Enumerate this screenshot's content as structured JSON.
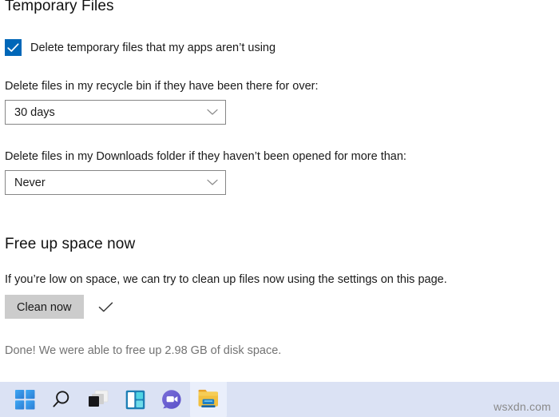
{
  "page": {
    "temp_files": {
      "title": "Temporary Files",
      "checkbox": {
        "label": "Delete temporary files that my apps aren’t using",
        "checked": true,
        "icon": "check-icon",
        "color": "#0067b8"
      },
      "recycle_bin": {
        "label": "Delete files in my recycle bin if they have been there for over:",
        "value": "30 days",
        "chevron_icon": "chevron-down-icon"
      },
      "downloads": {
        "label": "Delete files in my Downloads folder if they haven’t been opened for more than:",
        "value": "Never",
        "chevron_icon": "chevron-down-icon"
      }
    },
    "free_up_space": {
      "title": "Free up space now",
      "description": "If you’re low on space, we can try to clean up files now using the settings on this page.",
      "clean_button": "Clean now",
      "done_icon": "check-icon",
      "status": "Done! We were able to free up 2.98 GB of disk space."
    }
  },
  "taskbar": {
    "background": "#dbe2f4",
    "items": [
      {
        "name": "start-icon",
        "label": "Start",
        "active": false
      },
      {
        "name": "search-icon",
        "label": "Search",
        "active": false
      },
      {
        "name": "task-view-icon",
        "label": "Task View",
        "active": false
      },
      {
        "name": "widgets-icon",
        "label": "Widgets",
        "active": false
      },
      {
        "name": "chat-icon",
        "label": "Chat",
        "active": false
      },
      {
        "name": "file-explorer-icon",
        "label": "File Explorer",
        "active": true
      }
    ]
  },
  "watermark": "wsxdn.com"
}
